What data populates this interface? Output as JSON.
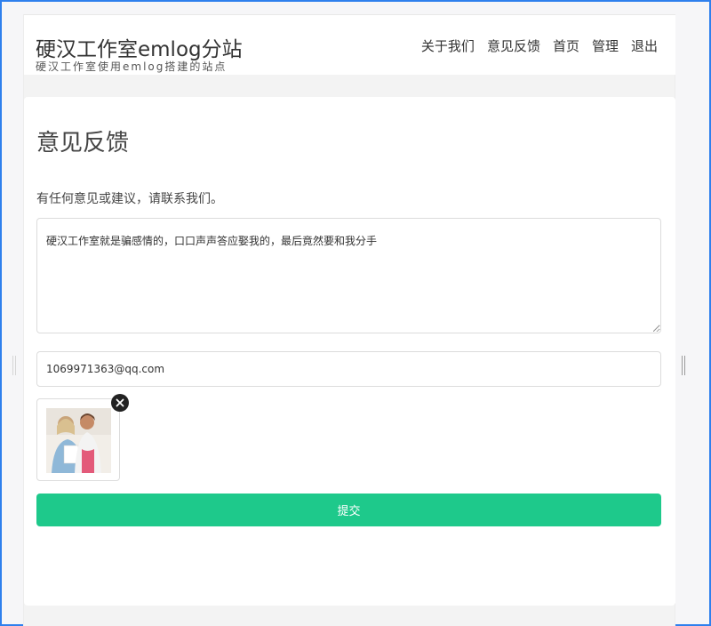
{
  "header": {
    "title": "硬汉工作室emlog分站",
    "subtitle": "硬汉工作室使用emlog搭建的站点",
    "nav": [
      {
        "label": "关于我们"
      },
      {
        "label": "意见反馈"
      },
      {
        "label": "首页"
      },
      {
        "label": "管理"
      },
      {
        "label": "退出"
      }
    ]
  },
  "feedback": {
    "title": "意见反馈",
    "intro": "有任何意见或建议，请联系我们。",
    "message_value": "硬汉工作室就是骗感情的，口口声声答应娶我的，最后竟然要和我分手",
    "email_value": "1069971363@qq.com",
    "attachment_icon": "photo-thumbnail",
    "remove_icon": "close-circle-icon",
    "submit_label": "提交"
  },
  "colors": {
    "accent": "#1ec98b",
    "frame": "#2f80ed"
  }
}
